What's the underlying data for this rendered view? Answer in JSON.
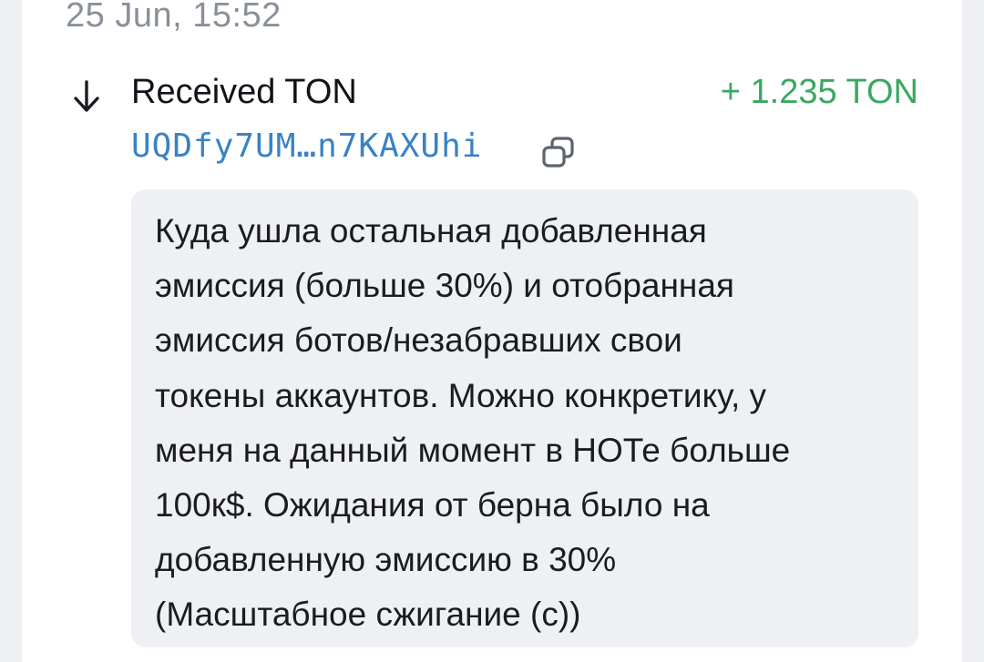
{
  "date": "25 Jun, 15:52",
  "transaction": {
    "direction_icon": "arrow-down-icon",
    "title": "Received TON",
    "amount": "+ 1.235 TON",
    "amount_color": "#3aa860",
    "address": "UQDfy7UM…n7KAXUhi",
    "address_color": "#3a82c4",
    "copy_icon": "copy-icon",
    "comment_lines": [
      "Куда ушла остальная добавленная",
      "эмиссия (больше 30%) и отобранная",
      "эмиссия ботов/незабравших свои",
      "токены аккаунтов. Можно конкретику, у",
      "меня на данный момент в НОТе больше",
      "100к$. Ожидания от берна было на",
      "добавленную эмиссию в 30%",
      "(Масштабное сжигание (с))"
    ]
  }
}
